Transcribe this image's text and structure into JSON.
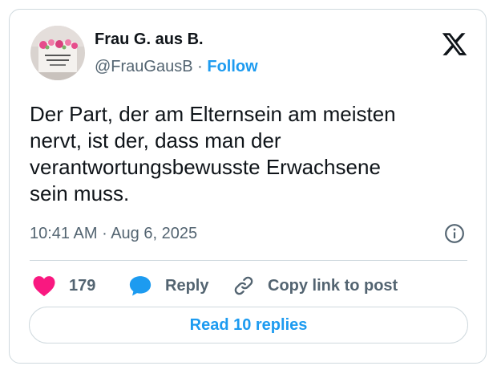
{
  "author": {
    "name": "Frau G. aus B.",
    "handle": "@FrauGausB",
    "separator": "·",
    "follow_label": "Follow",
    "avatar_icon": "mug-photo-avatar"
  },
  "post": {
    "text": "Der Part, der am Elternsein am meisten\nnervt, ist der, dass man der\nverantwortungsbewusste Erwachsene\nsein muss.",
    "time": "10:41 AM",
    "date_separator": "·",
    "date": "Aug 6, 2025"
  },
  "actions": {
    "like_count": "179",
    "reply_label": "Reply",
    "copy_label": "Copy link to post"
  },
  "read_replies_label": "Read 10 replies",
  "colors": {
    "accent": "#1d9bf0",
    "like": "#f91880",
    "text": "#0f1419",
    "secondary": "#536471",
    "border": "#cfd9de"
  },
  "icons": {
    "logo": "x-logo-icon",
    "info": "info-icon",
    "like": "heart-icon",
    "reply": "speech-bubble-icon",
    "copy": "link-icon"
  }
}
